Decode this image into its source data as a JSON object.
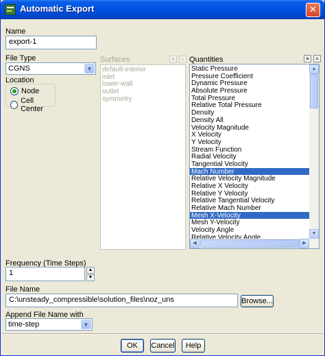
{
  "window": {
    "title": "Automatic Export",
    "close_glyph": "✕"
  },
  "name": {
    "label": "Name",
    "value": "export-1"
  },
  "file_type": {
    "label": "File Type",
    "value": "CGNS"
  },
  "location": {
    "label": "Location",
    "options": [
      "Node",
      "Cell Center"
    ],
    "selected": "Node"
  },
  "surfaces": {
    "label": "Surfaces",
    "items": [
      "default-interior",
      "inlet",
      "lower-wall",
      "outlet",
      "symmetry"
    ]
  },
  "quantities": {
    "label": "Quantities",
    "items": [
      "Static Pressure",
      "Pressure Coefficient",
      "Dynamic Pressure",
      "Absolute Pressure",
      "Total Pressure",
      "Relative Total Pressure",
      "Density",
      "Density All",
      "Velocity Magnitude",
      "X Velocity",
      "Y Velocity",
      "Stream Function",
      "Radial Velocity",
      "Tangential Velocity",
      "Mach Number",
      "Relative Velocity Magnitude",
      "Relative X Velocity",
      "Relative Y Velocity",
      "Relative Tangential Velocity",
      "Relative Mach Number",
      "Mesh X-Velocity",
      "Mesh Y-Velocity",
      "Velocity Angle",
      "Relative Velocity Angle"
    ],
    "selected": [
      "Mach Number",
      "Mesh X-Velocity"
    ]
  },
  "frequency": {
    "label": "Frequency (Time Steps)",
    "value": "1"
  },
  "file_name": {
    "label": "File Name",
    "value": "C:\\unsteady_compressible\\solution_files\\noz_uns",
    "browse_label": "Browse..."
  },
  "append": {
    "label": "Append File Name with",
    "value": "time-step"
  },
  "buttons": {
    "ok": "OK",
    "cancel": "Cancel",
    "help": "Help"
  },
  "colors": {
    "titlebar": "#0054e3",
    "selection": "#316ac5",
    "dialog_bg": "#ece9d8"
  }
}
